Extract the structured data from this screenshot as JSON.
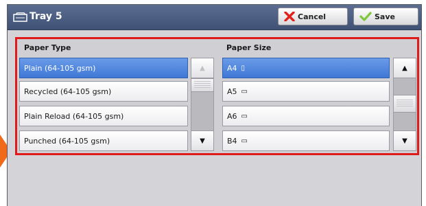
{
  "window": {
    "title": "Tray 5",
    "cancel_label": "Cancel",
    "save_label": "Save"
  },
  "paper_type": {
    "header": "Paper Type",
    "items": [
      {
        "label": "Plain (64-105 gsm)",
        "selected": true
      },
      {
        "label": "Recycled (64-105 gsm)",
        "selected": false
      },
      {
        "label": "Plain Reload (64-105 gsm)",
        "selected": false
      },
      {
        "label": "Punched (64-105 gsm)",
        "selected": false
      }
    ],
    "scroll_up_enabled": false,
    "scroll_down_enabled": true
  },
  "paper_size": {
    "header": "Paper Size",
    "items": [
      {
        "label": "A4",
        "orientation_icon": "portrait-page-icon",
        "glyph": "▯",
        "selected": true
      },
      {
        "label": "A5",
        "orientation_icon": "landscape-page-icon",
        "glyph": "▭",
        "selected": false
      },
      {
        "label": "A6",
        "orientation_icon": "landscape-page-icon",
        "glyph": "▭",
        "selected": false
      },
      {
        "label": "B4",
        "orientation_icon": "landscape-page-icon",
        "glyph": "▭",
        "selected": false
      }
    ],
    "scroll_up_enabled": true,
    "scroll_down_enabled": true
  },
  "colors": {
    "highlight_frame": "#e01a1a",
    "callout_arrow": "#f06a1a",
    "selection": "#3f78d6"
  }
}
